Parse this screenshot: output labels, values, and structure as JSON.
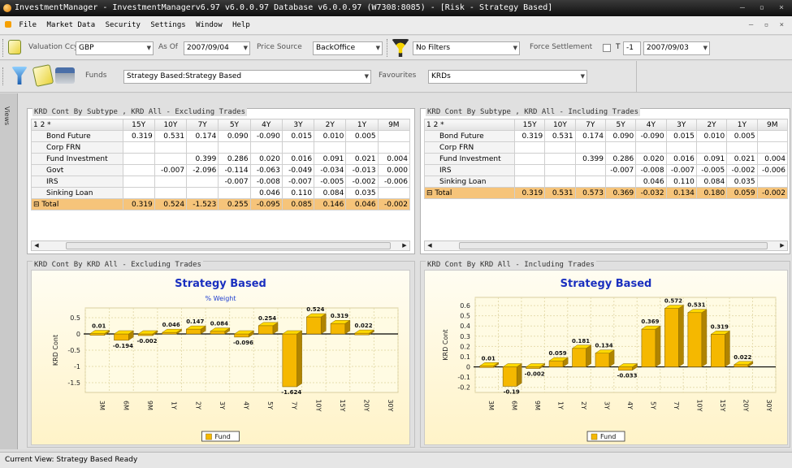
{
  "window": {
    "title": "InvestmentManager - InvestmentManagerv6.97 v6.0.0.97 Database v6.0.0.97 (W7308:8085) - [Risk - Strategy Based]",
    "controls": "– ▫ ×"
  },
  "menu": {
    "items": [
      "File",
      "Market Data",
      "Security",
      "Settings",
      "Window",
      "Help"
    ],
    "mdi_controls": "– ▫ ×"
  },
  "toolbar1": {
    "valuation_ccy_label": "Valuation Ccy",
    "valuation_ccy_value": "GBP",
    "as_of_label": "As Of",
    "as_of_value": "2007/09/04",
    "price_source_label": "Price Source",
    "price_source_value": "BackOffice",
    "filter_value": "No Filters",
    "force_settlement_label": "Force Settlement",
    "t_label": "T",
    "t_offset": "-1",
    "settlement_date": "2007/09/03"
  },
  "toolbar2": {
    "funds_label": "Funds",
    "funds_value": "Strategy Based:Strategy Based",
    "favourites_label": "Favourites",
    "favourites_value": "KRDs"
  },
  "views_label": "Views",
  "tables": [
    {
      "title": "KRD Cont By Subtype , KRD All - Excluding Trades",
      "corner": "1 2 *",
      "columns": [
        "15Y",
        "10Y",
        "7Y",
        "5Y",
        "4Y",
        "3Y",
        "2Y",
        "1Y",
        "9M"
      ],
      "rows": [
        {
          "label": "Bond Future",
          "cells": [
            "0.319",
            "0.531",
            "0.174",
            "0.090",
            "-0.090",
            "0.015",
            "0.010",
            "0.005",
            ""
          ]
        },
        {
          "label": "Corp FRN",
          "cells": [
            "",
            "",
            "",
            "",
            "",
            "",
            "",
            "",
            ""
          ]
        },
        {
          "label": "Fund Investment",
          "cells": [
            "",
            "",
            "0.399",
            "0.286",
            "0.020",
            "0.016",
            "0.091",
            "0.021",
            "0.004"
          ]
        },
        {
          "label": "Govt",
          "cells": [
            "",
            "-0.007",
            "-2.096",
            "-0.114",
            "-0.063",
            "-0.049",
            "-0.034",
            "-0.013",
            "0.000"
          ]
        },
        {
          "label": "IRS",
          "cells": [
            "",
            "",
            "",
            "-0.007",
            "-0.008",
            "-0.007",
            "-0.005",
            "-0.002",
            "-0.006"
          ]
        },
        {
          "label": "Sinking Loan",
          "cells": [
            "",
            "",
            "",
            "",
            "0.046",
            "0.110",
            "0.084",
            "0.035",
            ""
          ]
        }
      ],
      "total": {
        "label": "Total",
        "cells": [
          "0.319",
          "0.524",
          "-1.523",
          "0.255",
          "-0.095",
          "0.085",
          "0.146",
          "0.046",
          "-0.002"
        ]
      }
    },
    {
      "title": "KRD Cont By Subtype , KRD All - Including Trades",
      "corner": "1 2 *",
      "columns": [
        "15Y",
        "10Y",
        "7Y",
        "5Y",
        "4Y",
        "3Y",
        "2Y",
        "1Y",
        "9M"
      ],
      "rows": [
        {
          "label": "Bond Future",
          "cells": [
            "0.319",
            "0.531",
            "0.174",
            "0.090",
            "-0.090",
            "0.015",
            "0.010",
            "0.005",
            ""
          ]
        },
        {
          "label": "Corp FRN",
          "cells": [
            "",
            "",
            "",
            "",
            "",
            "",
            "",
            "",
            ""
          ]
        },
        {
          "label": "Fund Investment",
          "cells": [
            "",
            "",
            "0.399",
            "0.286",
            "0.020",
            "0.016",
            "0.091",
            "0.021",
            "0.004"
          ]
        },
        {
          "label": "IRS",
          "cells": [
            "",
            "",
            "",
            "-0.007",
            "-0.008",
            "-0.007",
            "-0.005",
            "-0.002",
            "-0.006"
          ]
        },
        {
          "label": "Sinking Loan",
          "cells": [
            "",
            "",
            "",
            "",
            "0.046",
            "0.110",
            "0.084",
            "0.035",
            ""
          ]
        }
      ],
      "total": {
        "label": "Total",
        "cells": [
          "0.319",
          "0.531",
          "0.573",
          "0.369",
          "-0.032",
          "0.134",
          "0.180",
          "0.059",
          "-0.002"
        ]
      }
    }
  ],
  "chart_panels": [
    {
      "panel_title": "KRD Cont By KRD All - Excluding Trades"
    },
    {
      "panel_title": "KRD Cont By KRD All - Including Trades"
    }
  ],
  "chart_data": [
    {
      "type": "bar",
      "title": "Strategy Based",
      "subtitle": "% Weight",
      "ylabel": "KRD Cont",
      "xlabel": "",
      "categories": [
        "3M",
        "6M",
        "9M",
        "1Y",
        "2Y",
        "3Y",
        "4Y",
        "5Y",
        "7Y",
        "10Y",
        "15Y",
        "20Y",
        "30Y"
      ],
      "series": [
        {
          "name": "Fund",
          "values": [
            0.01,
            -0.194,
            -0.002,
            0.046,
            0.147,
            0.084,
            -0.096,
            0.254,
            -1.624,
            0.524,
            0.319,
            0.022,
            null
          ]
        }
      ],
      "ylim": [
        -1.8,
        0.8
      ],
      "yticks": [
        0.5,
        0,
        -0.5,
        -1,
        -1.5
      ],
      "grid": true,
      "legend": "bottom-center",
      "color": "#f5b800"
    },
    {
      "type": "bar",
      "title": "Strategy Based",
      "subtitle": "",
      "ylabel": "KRD Cont",
      "xlabel": "",
      "categories": [
        "3M",
        "6M",
        "9M",
        "1Y",
        "2Y",
        "3Y",
        "4Y",
        "5Y",
        "7Y",
        "10Y",
        "15Y",
        "20Y",
        "30Y"
      ],
      "series": [
        {
          "name": "Fund",
          "values": [
            0.01,
            -0.19,
            -0.002,
            0.059,
            0.181,
            0.134,
            -0.033,
            0.369,
            0.572,
            0.531,
            0.319,
            0.022,
            null
          ]
        }
      ],
      "ylim": [
        -0.25,
        0.68
      ],
      "yticks": [
        0.6,
        0.5,
        0.4,
        0.3,
        0.2,
        0.1,
        0,
        -0.1,
        -0.2
      ],
      "grid": true,
      "legend": "bottom-center",
      "color": "#f5b800"
    }
  ],
  "status": {
    "text": "Current View: Strategy Based  Ready"
  }
}
